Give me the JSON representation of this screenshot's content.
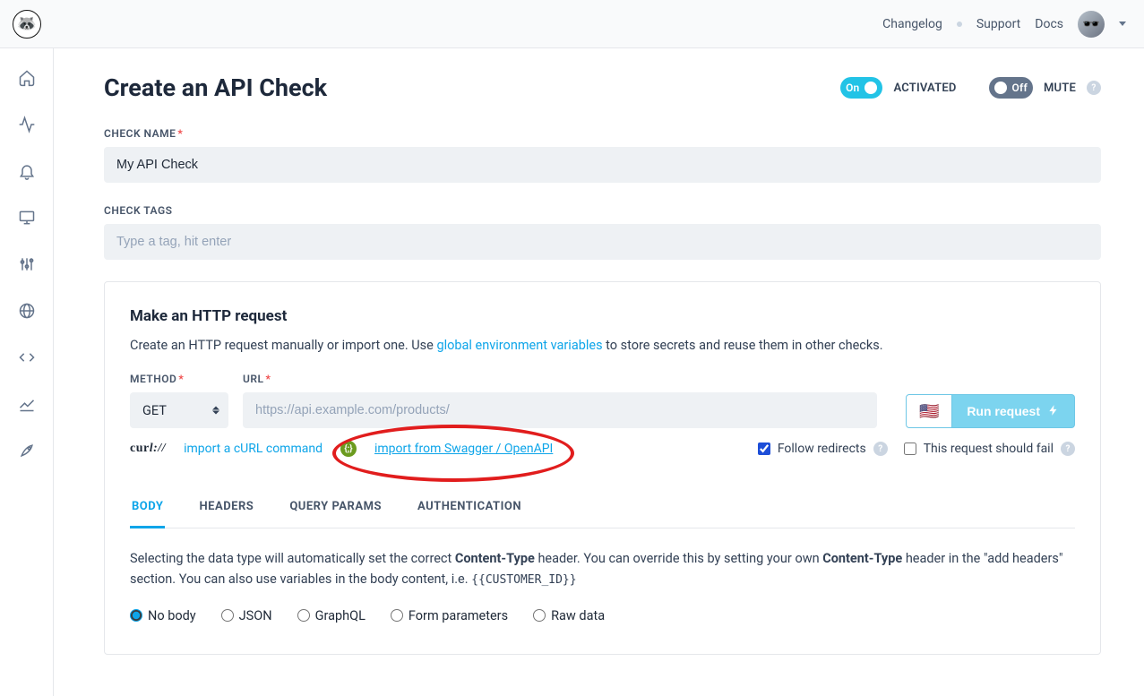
{
  "header": {
    "links": [
      "Changelog",
      "Support",
      "Docs"
    ]
  },
  "page": {
    "title": "Create an API Check",
    "activated_toggle": {
      "on_label": "On",
      "state_label": "ACTIVATED"
    },
    "mute_toggle": {
      "off_label": "Off",
      "state_label": "MUTE"
    }
  },
  "fields": {
    "check_name": {
      "label": "CHECK NAME",
      "value": "My API Check"
    },
    "check_tags": {
      "label": "CHECK TAGS",
      "placeholder": "Type a tag, hit enter"
    }
  },
  "request_card": {
    "heading": "Make an HTTP request",
    "desc_pre": "Create an HTTP request manually or import one. Use ",
    "desc_link": "global environment variables",
    "desc_post": " to store secrets and reuse them in other checks.",
    "method": {
      "label": "METHOD",
      "value": "GET"
    },
    "url": {
      "label": "URL",
      "placeholder": "https://api.example.com/products/"
    },
    "run_button": "Run request",
    "import_curl": "import a cURL command",
    "import_swagger": "import from Swagger / OpenAPI",
    "follow_redirects": "Follow redirects",
    "should_fail": "This request should fail"
  },
  "tabs": {
    "items": [
      "BODY",
      "HEADERS",
      "QUERY PARAMS",
      "AUTHENTICATION"
    ],
    "active_index": 0,
    "body_desc_1": "Selecting the data type will automatically set the correct ",
    "body_ct1": "Content-Type",
    "body_desc_2": " header. You can override this by setting your own ",
    "body_ct2": "Content-Type",
    "body_desc_3": " header in the \"add headers\" section. You can also use variables in the body content, i.e. ",
    "body_example": "{{CUSTOMER_ID}}",
    "radios": [
      "No body",
      "JSON",
      "GraphQL",
      "Form parameters",
      "Raw data"
    ],
    "radio_selected": 0
  }
}
